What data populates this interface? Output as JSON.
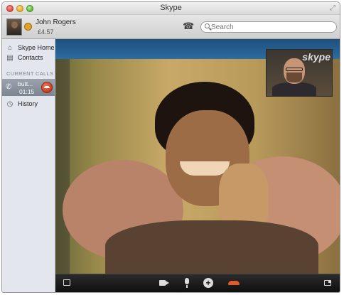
{
  "window": {
    "title": "Skype"
  },
  "account": {
    "name": "John Rogers",
    "credit": "£4.57"
  },
  "search": {
    "placeholder": "Search"
  },
  "sidebar": {
    "items": [
      {
        "label": "Skype Home",
        "icon": "home-icon"
      },
      {
        "label": "Contacts",
        "icon": "contacts-icon"
      }
    ],
    "current_calls_heading": "CURRENT CALLS",
    "current_call": {
      "name": "butt...",
      "duration": "01:15"
    },
    "history": {
      "label": "History",
      "icon": "history-icon"
    }
  },
  "video": {
    "self_view_watermark": "skype"
  },
  "controls": {
    "plus_symbol": "+"
  },
  "colors": {
    "hangup": "#e05a2a",
    "sidebar_bg": "#e3e7ed",
    "active_call_bg": "#8a939d",
    "control_bar_bg": "#1a1a1a"
  }
}
